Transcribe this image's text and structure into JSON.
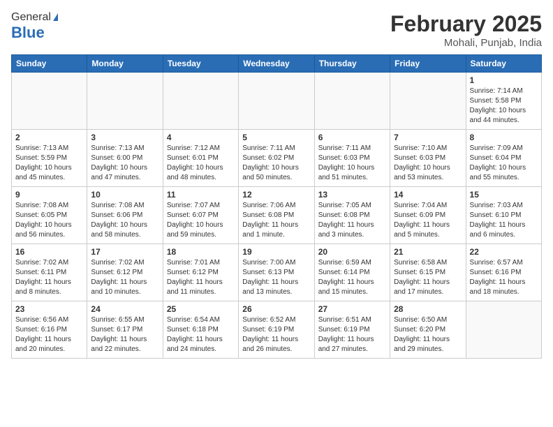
{
  "header": {
    "logo_line1": "General",
    "logo_line2": "Blue",
    "month_title": "February 2025",
    "location": "Mohali, Punjab, India"
  },
  "days_of_week": [
    "Sunday",
    "Monday",
    "Tuesday",
    "Wednesday",
    "Thursday",
    "Friday",
    "Saturday"
  ],
  "weeks": [
    [
      {
        "day": "",
        "info": ""
      },
      {
        "day": "",
        "info": ""
      },
      {
        "day": "",
        "info": ""
      },
      {
        "day": "",
        "info": ""
      },
      {
        "day": "",
        "info": ""
      },
      {
        "day": "",
        "info": ""
      },
      {
        "day": "1",
        "info": "Sunrise: 7:14 AM\nSunset: 5:58 PM\nDaylight: 10 hours\nand 44 minutes."
      }
    ],
    [
      {
        "day": "2",
        "info": "Sunrise: 7:13 AM\nSunset: 5:59 PM\nDaylight: 10 hours\nand 45 minutes."
      },
      {
        "day": "3",
        "info": "Sunrise: 7:13 AM\nSunset: 6:00 PM\nDaylight: 10 hours\nand 47 minutes."
      },
      {
        "day": "4",
        "info": "Sunrise: 7:12 AM\nSunset: 6:01 PM\nDaylight: 10 hours\nand 48 minutes."
      },
      {
        "day": "5",
        "info": "Sunrise: 7:11 AM\nSunset: 6:02 PM\nDaylight: 10 hours\nand 50 minutes."
      },
      {
        "day": "6",
        "info": "Sunrise: 7:11 AM\nSunset: 6:03 PM\nDaylight: 10 hours\nand 51 minutes."
      },
      {
        "day": "7",
        "info": "Sunrise: 7:10 AM\nSunset: 6:03 PM\nDaylight: 10 hours\nand 53 minutes."
      },
      {
        "day": "8",
        "info": "Sunrise: 7:09 AM\nSunset: 6:04 PM\nDaylight: 10 hours\nand 55 minutes."
      }
    ],
    [
      {
        "day": "9",
        "info": "Sunrise: 7:08 AM\nSunset: 6:05 PM\nDaylight: 10 hours\nand 56 minutes."
      },
      {
        "day": "10",
        "info": "Sunrise: 7:08 AM\nSunset: 6:06 PM\nDaylight: 10 hours\nand 58 minutes."
      },
      {
        "day": "11",
        "info": "Sunrise: 7:07 AM\nSunset: 6:07 PM\nDaylight: 10 hours\nand 59 minutes."
      },
      {
        "day": "12",
        "info": "Sunrise: 7:06 AM\nSunset: 6:08 PM\nDaylight: 11 hours\nand 1 minute."
      },
      {
        "day": "13",
        "info": "Sunrise: 7:05 AM\nSunset: 6:08 PM\nDaylight: 11 hours\nand 3 minutes."
      },
      {
        "day": "14",
        "info": "Sunrise: 7:04 AM\nSunset: 6:09 PM\nDaylight: 11 hours\nand 5 minutes."
      },
      {
        "day": "15",
        "info": "Sunrise: 7:03 AM\nSunset: 6:10 PM\nDaylight: 11 hours\nand 6 minutes."
      }
    ],
    [
      {
        "day": "16",
        "info": "Sunrise: 7:02 AM\nSunset: 6:11 PM\nDaylight: 11 hours\nand 8 minutes."
      },
      {
        "day": "17",
        "info": "Sunrise: 7:02 AM\nSunset: 6:12 PM\nDaylight: 11 hours\nand 10 minutes."
      },
      {
        "day": "18",
        "info": "Sunrise: 7:01 AM\nSunset: 6:12 PM\nDaylight: 11 hours\nand 11 minutes."
      },
      {
        "day": "19",
        "info": "Sunrise: 7:00 AM\nSunset: 6:13 PM\nDaylight: 11 hours\nand 13 minutes."
      },
      {
        "day": "20",
        "info": "Sunrise: 6:59 AM\nSunset: 6:14 PM\nDaylight: 11 hours\nand 15 minutes."
      },
      {
        "day": "21",
        "info": "Sunrise: 6:58 AM\nSunset: 6:15 PM\nDaylight: 11 hours\nand 17 minutes."
      },
      {
        "day": "22",
        "info": "Sunrise: 6:57 AM\nSunset: 6:16 PM\nDaylight: 11 hours\nand 18 minutes."
      }
    ],
    [
      {
        "day": "23",
        "info": "Sunrise: 6:56 AM\nSunset: 6:16 PM\nDaylight: 11 hours\nand 20 minutes."
      },
      {
        "day": "24",
        "info": "Sunrise: 6:55 AM\nSunset: 6:17 PM\nDaylight: 11 hours\nand 22 minutes."
      },
      {
        "day": "25",
        "info": "Sunrise: 6:54 AM\nSunset: 6:18 PM\nDaylight: 11 hours\nand 24 minutes."
      },
      {
        "day": "26",
        "info": "Sunrise: 6:52 AM\nSunset: 6:19 PM\nDaylight: 11 hours\nand 26 minutes."
      },
      {
        "day": "27",
        "info": "Sunrise: 6:51 AM\nSunset: 6:19 PM\nDaylight: 11 hours\nand 27 minutes."
      },
      {
        "day": "28",
        "info": "Sunrise: 6:50 AM\nSunset: 6:20 PM\nDaylight: 11 hours\nand 29 minutes."
      },
      {
        "day": "",
        "info": ""
      }
    ]
  ]
}
